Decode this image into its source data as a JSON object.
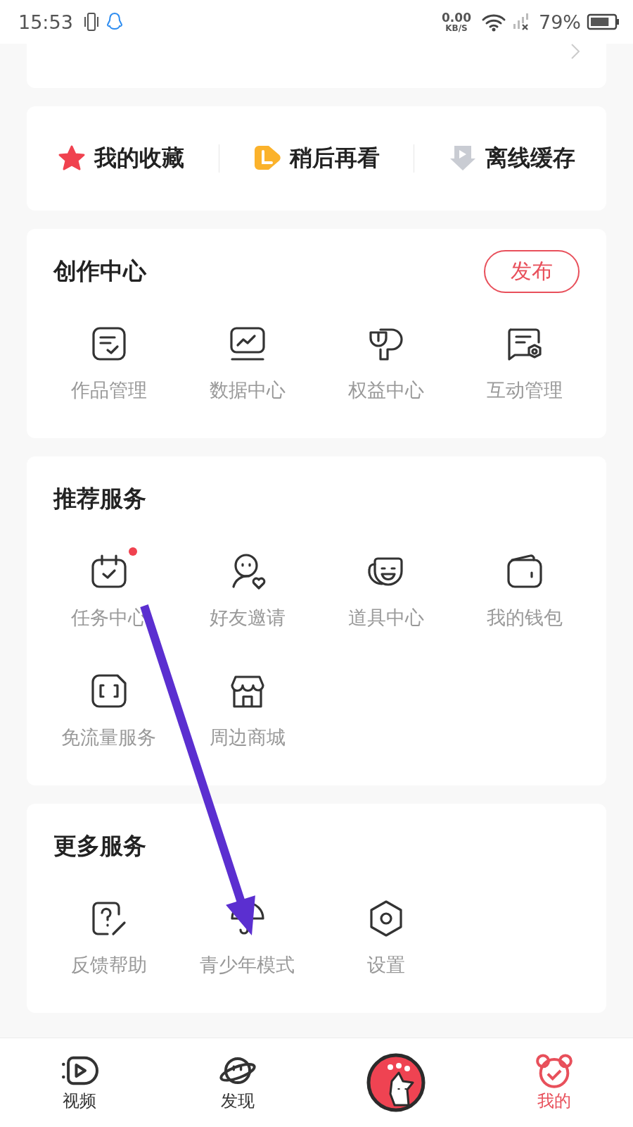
{
  "status_bar": {
    "time": "15:53",
    "net_speed": "0.00",
    "net_unit": "KB/S",
    "battery": "79%"
  },
  "quick_links": [
    {
      "label": "我的收藏",
      "kind": "star"
    },
    {
      "label": "稍后再看",
      "kind": "later"
    },
    {
      "label": "离线缓存",
      "kind": "download"
    }
  ],
  "sections": [
    {
      "title": "创作中心",
      "action": "发布",
      "items": [
        {
          "label": "作品管理",
          "kind": "works",
          "badge": false
        },
        {
          "label": "数据中心",
          "kind": "chart",
          "badge": false
        },
        {
          "label": "权益中心",
          "kind": "rights",
          "badge": false
        },
        {
          "label": "互动管理",
          "kind": "chat",
          "badge": false
        }
      ]
    },
    {
      "title": "推荐服务",
      "items": [
        {
          "label": "任务中心",
          "kind": "calendar",
          "badge": true
        },
        {
          "label": "好友邀请",
          "kind": "friend",
          "badge": false
        },
        {
          "label": "道具中心",
          "kind": "mask",
          "badge": false
        },
        {
          "label": "我的钱包",
          "kind": "wallet",
          "badge": false
        },
        {
          "label": "免流量服务",
          "kind": "sim",
          "badge": false
        },
        {
          "label": "周边商城",
          "kind": "shop",
          "badge": false
        }
      ]
    },
    {
      "title": "更多服务",
      "items": [
        {
          "label": "反馈帮助",
          "kind": "help",
          "badge": false
        },
        {
          "label": "青少年模式",
          "kind": "umbrella",
          "badge": false
        },
        {
          "label": "设置",
          "kind": "settings",
          "badge": false
        }
      ]
    }
  ],
  "tabs": [
    {
      "label": "视频",
      "kind": "video",
      "selected": false
    },
    {
      "label": "发现",
      "kind": "planet",
      "selected": false
    },
    {
      "kind": "center"
    },
    {
      "label": "我的",
      "kind": "bear",
      "selected": true
    }
  ]
}
